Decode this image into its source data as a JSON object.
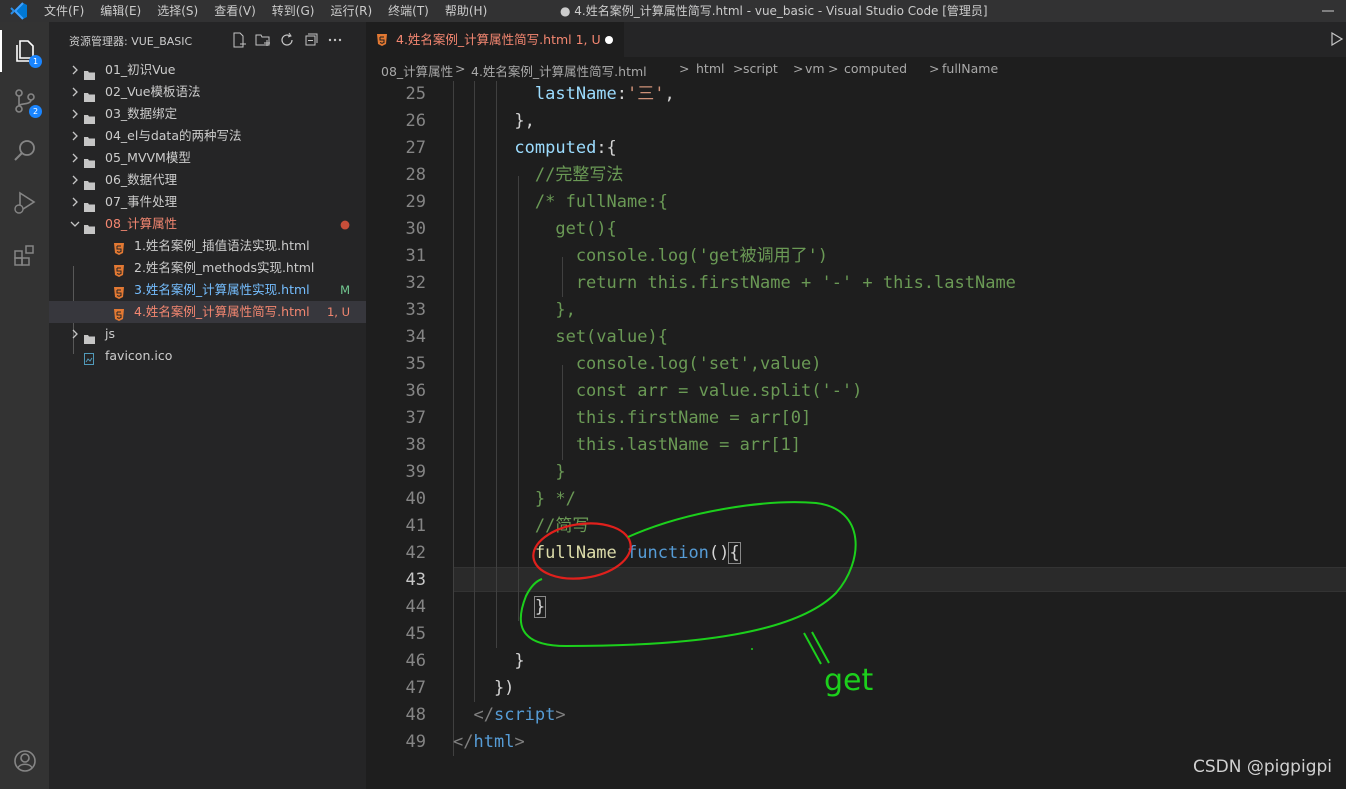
{
  "titlebar": {
    "menu": [
      "文件(F)",
      "编辑(E)",
      "选择(S)",
      "查看(V)",
      "转到(G)",
      "运行(R)",
      "终端(T)",
      "帮助(H)"
    ],
    "title": "● 4.姓名案例_计算属性简写.html - vue_basic - Visual Studio Code [管理员]"
  },
  "activitybar": {
    "explorer_badge": "1",
    "scm_badge": "2"
  },
  "sidebar": {
    "header": "资源管理器: VUE_BASIC",
    "items": [
      {
        "chevron": ">",
        "label": "01_初识Vue",
        "status": ""
      },
      {
        "chevron": ">",
        "label": "02_Vue模板语法",
        "status": ""
      },
      {
        "chevron": ">",
        "label": "03_数据绑定",
        "status": ""
      },
      {
        "chevron": ">",
        "label": "04_el与data的两种写法",
        "status": ""
      },
      {
        "chevron": ">",
        "label": "05_MVVM模型",
        "status": ""
      },
      {
        "chevron": ">",
        "label": "06_数据代理",
        "status": ""
      },
      {
        "chevron": ">",
        "label": "07_事件处理",
        "status": ""
      },
      {
        "chevron": "v",
        "label": "08_计算属性",
        "status": "●"
      },
      {
        "chevron": "",
        "label": "1.姓名案例_插值语法实现.html",
        "status": ""
      },
      {
        "chevron": "",
        "label": "2.姓名案例_methods实现.html",
        "status": ""
      },
      {
        "chevron": "",
        "label": "3.姓名案例_计算属性实现.html",
        "status": "M"
      },
      {
        "chevron": "",
        "label": "4.姓名案例_计算属性简写.html",
        "status": "1, U"
      },
      {
        "chevron": ">",
        "label": "js",
        "status": ""
      },
      {
        "chevron": "",
        "label": "favicon.ico",
        "status": ""
      }
    ]
  },
  "editor": {
    "tab_label": "4.姓名案例_计算属性简写.html  1, U",
    "breadcrumb": [
      "08_计算属性",
      ">",
      "4.姓名案例_计算属性简写.html",
      ">",
      "html",
      ">",
      "script",
      ">",
      "vm",
      ">",
      "computed",
      ">",
      "fullName"
    ],
    "lines": [
      {
        "n": "25",
        "tokens": [
          [
            "",
            "        "
          ],
          [
            "p",
            "lastName"
          ],
          [
            "",
            ":"
          ],
          [
            "s",
            "'三'"
          ],
          [
            "",
            ","
          ]
        ]
      },
      {
        "n": "26",
        "tokens": [
          [
            "",
            "      },"
          ]
        ]
      },
      {
        "n": "27",
        "tokens": [
          [
            "",
            "      "
          ],
          [
            "p",
            "computed"
          ],
          [
            "",
            ":{"
          ]
        ]
      },
      {
        "n": "28",
        "tokens": [
          [
            "",
            "        "
          ],
          [
            "c",
            "//完整写法"
          ]
        ]
      },
      {
        "n": "29",
        "tokens": [
          [
            "",
            "        "
          ],
          [
            "c",
            "/* fullName:{"
          ]
        ]
      },
      {
        "n": "30",
        "tokens": [
          [
            "c",
            "          get(){"
          ]
        ]
      },
      {
        "n": "31",
        "tokens": [
          [
            "c",
            "            console.log('get被调用了')"
          ]
        ]
      },
      {
        "n": "32",
        "tokens": [
          [
            "c",
            "            return this.firstName + '-' + this.lastName"
          ]
        ]
      },
      {
        "n": "33",
        "tokens": [
          [
            "c",
            "          },"
          ]
        ]
      },
      {
        "n": "34",
        "tokens": [
          [
            "c",
            "          set(value){"
          ]
        ]
      },
      {
        "n": "35",
        "tokens": [
          [
            "c",
            "            console.log('set',value)"
          ]
        ]
      },
      {
        "n": "36",
        "tokens": [
          [
            "c",
            "            const arr = value.split('-')"
          ]
        ]
      },
      {
        "n": "37",
        "tokens": [
          [
            "c",
            "            this.firstName = arr[0]"
          ]
        ]
      },
      {
        "n": "38",
        "tokens": [
          [
            "c",
            "            this.lastName = arr[1]"
          ]
        ]
      },
      {
        "n": "39",
        "tokens": [
          [
            "c",
            "          }"
          ]
        ]
      },
      {
        "n": "40",
        "tokens": [
          [
            "c",
            "        } */"
          ]
        ]
      },
      {
        "n": "41",
        "tokens": [
          [
            "",
            "        "
          ],
          [
            "c",
            "//简写"
          ]
        ]
      },
      {
        "n": "42",
        "tokens": [
          [
            "",
            "        "
          ],
          [
            "f",
            "fullName"
          ],
          [
            "",
            " "
          ],
          [
            "k",
            "function"
          ],
          [
            "",
            "()"
          ],
          [
            "br",
            "{"
          ]
        ]
      },
      {
        "n": "43",
        "tokens": [
          [
            "",
            ""
          ]
        ]
      },
      {
        "n": "44",
        "tokens": [
          [
            "",
            "        "
          ],
          [
            "br",
            "}"
          ]
        ]
      },
      {
        "n": "45",
        "tokens": [
          [
            "",
            ""
          ]
        ]
      },
      {
        "n": "46",
        "tokens": [
          [
            "",
            "      }"
          ]
        ]
      },
      {
        "n": "47",
        "tokens": [
          [
            "",
            "    })"
          ]
        ]
      },
      {
        "n": "48",
        "tokens": [
          [
            "",
            "  "
          ],
          [
            "g",
            "</"
          ],
          [
            "t",
            "script"
          ],
          [
            "g",
            ">"
          ]
        ]
      },
      {
        "n": "49",
        "tokens": [
          [
            "g",
            "</"
          ],
          [
            "t",
            "html"
          ],
          [
            "g",
            ">"
          ]
        ]
      }
    ]
  },
  "annotation": {
    "text": "get"
  },
  "watermark": "CSDN @pigpigpi"
}
